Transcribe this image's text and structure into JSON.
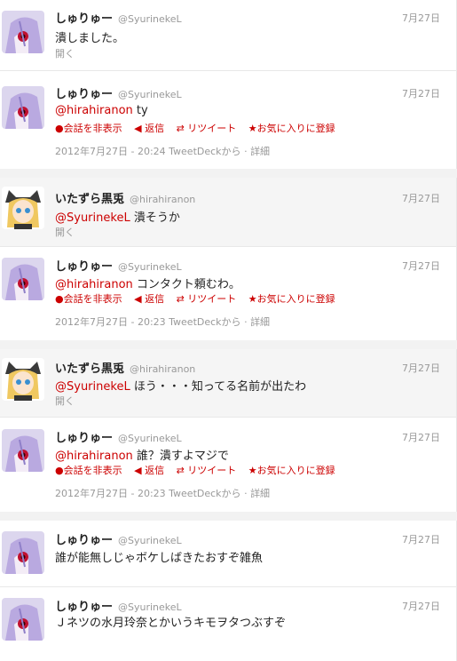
{
  "ui": {
    "open_label": "開く",
    "actions": {
      "hide": "会話を非表示",
      "reply": "返信",
      "retweet": "リツイート",
      "favorite": "お気に入りに登録"
    },
    "details": "詳細",
    "meta_sep": "·"
  },
  "tweets": [
    {
      "name": "しゅりゅー",
      "handle": "@SyurinekeL",
      "date": "7月27日",
      "text": "潰しました。"
    },
    {
      "name": "しゅりゅー",
      "handle": "@SyurinekeL",
      "date": "7月27日",
      "mention": "@hirahiranon",
      "text": " ty",
      "timestamp": "2012年7月27日 - 20:24 TweetDeckから"
    },
    {
      "name": "いたずら黒兎",
      "handle": "@hirahiranon",
      "date": "7月27日",
      "mention": "@SyurinekeL",
      "text": " 潰そうか"
    },
    {
      "name": "しゅりゅー",
      "handle": "@SyurinekeL",
      "date": "7月27日",
      "mention": "@hirahiranon",
      "text": " コンタクト頼むわ。",
      "timestamp": "2012年7月27日 - 20:23 TweetDeckから"
    },
    {
      "name": "いたずら黒兎",
      "handle": "@hirahiranon",
      "date": "7月27日",
      "mention": "@SyurinekeL",
      "text": " ほう・・・知ってる名前が出たわ"
    },
    {
      "name": "しゅりゅー",
      "handle": "@SyurinekeL",
      "date": "7月27日",
      "mention": "@hirahiranon",
      "text": " 誰？潰すよマジで",
      "timestamp": "2012年7月27日 - 20:23 TweetDeckから"
    },
    {
      "name": "しゅりゅー",
      "handle": "@SyurinekeL",
      "date": "7月27日",
      "text": "誰が能無しじゃボケしばきたおすぞ雑魚"
    },
    {
      "name": "しゅりゅー",
      "handle": "@SyurinekeL",
      "date": "7月27日",
      "text": "Ｊネツの水月玲奈とかいうキモヲタつぶすぞ"
    }
  ]
}
